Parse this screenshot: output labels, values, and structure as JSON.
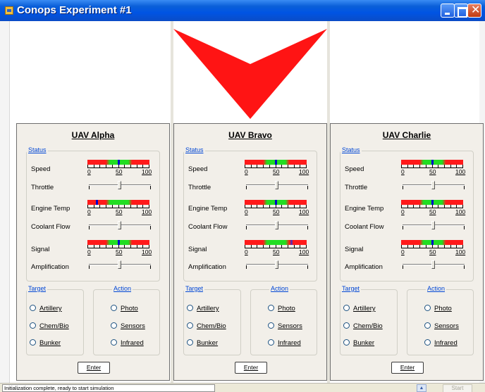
{
  "window": {
    "title": "Conops Experiment #1"
  },
  "arrow": {
    "color": "#ff1414",
    "direction": "down"
  },
  "labels": {
    "status_group": "Status",
    "target_group": "Target",
    "action_group": "Action",
    "speed": "Speed",
    "throttle": "Throttle",
    "engine_temp": "Engine Temp",
    "coolant_flow": "Coolant Flow",
    "signal": "Signal",
    "amplification": "Amplification",
    "scale_min": "0",
    "scale_mid": "50",
    "scale_max": "100",
    "enter": "Enter"
  },
  "targets": [
    "Artillery",
    "Chem/Bio",
    "Bunker"
  ],
  "actions": [
    "Photo",
    "Sensors",
    "Infrared"
  ],
  "colors": {
    "gauge_low": "#ff1a1a",
    "gauge_mid": "#22dd22",
    "marker_blue": "#0000cc",
    "marker_purple": "#6a2aa0"
  },
  "uavs": [
    {
      "name": "UAV Alpha",
      "speed": 50,
      "engine_temp": 15,
      "signal": 50,
      "throttle": 50,
      "coolant_flow": 50,
      "amplification": 50
    },
    {
      "name": "UAV Bravo",
      "speed": 50,
      "engine_temp": 50,
      "signal": 75,
      "throttle": 50,
      "coolant_flow": 50,
      "amplification": 50
    },
    {
      "name": "UAV Charlie",
      "speed": 50,
      "engine_temp": 50,
      "signal": 50,
      "throttle": 50,
      "coolant_flow": 50,
      "amplification": 50
    }
  ],
  "statusbar": {
    "message": "Initialization complete, ready to start simulation",
    "start_label": "Start"
  }
}
